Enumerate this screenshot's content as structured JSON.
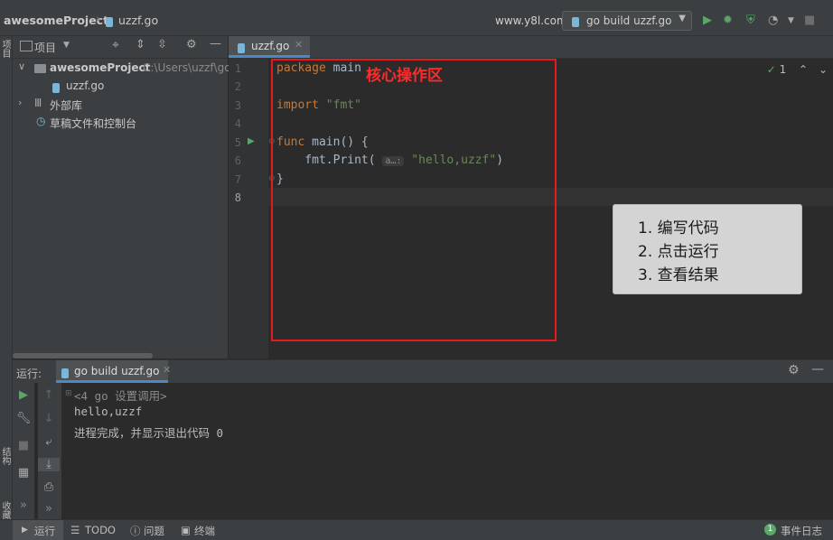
{
  "navbar": {
    "project": "awesomeProject",
    "file": "uzzf.go",
    "site": "www.y8l.com",
    "run_config": "go build uzzf.go"
  },
  "left_strip": {
    "top_label": "项目",
    "mid_label": "结构",
    "bottom_label": "收藏夹"
  },
  "project_panel": {
    "title": "项目",
    "tree": [
      {
        "label": "awesomeProject",
        "path": "C:\\Users\\uzzf\\go"
      },
      {
        "label": "uzzf.go"
      },
      {
        "label": "外部库"
      },
      {
        "label": "草稿文件和控制台"
      }
    ]
  },
  "editor": {
    "tab": "uzzf.go",
    "line_numbers": [
      "1",
      "2",
      "3",
      "4",
      "5",
      "6",
      "7",
      "8"
    ],
    "code": {
      "l1_kw": "package",
      "l1_rest": " main",
      "l3_kw": "import",
      "l3_str": " \"fmt\"",
      "l5_kw": "func",
      "l5_rest": " main() {",
      "l6_a": "    fmt.Print( ",
      "l6_hint": "a…:",
      "l6_str": " \"hello,uzzf\"",
      "l6_b": ")",
      "l7": "}"
    },
    "inspection_count": "1",
    "annotation_title": "核心操作区",
    "steps": [
      "1. 编写代码",
      "2. 点击运行",
      "3. 查看结果"
    ]
  },
  "run_panel": {
    "label": "运行:",
    "tab": "go build uzzf.go",
    "console": [
      "<4 go 设置调用>",
      "hello,uzzf",
      "进程完成，并显示退出代码 0"
    ]
  },
  "status_bar": {
    "run": "运行",
    "todo": "TODO",
    "problems": "问题",
    "terminal": "终端",
    "event_count": "1",
    "event_log": "事件日志"
  },
  "colors": {
    "accent": "#4a88c7",
    "annotation": "#e41b1b",
    "run_green": "#59a869"
  }
}
